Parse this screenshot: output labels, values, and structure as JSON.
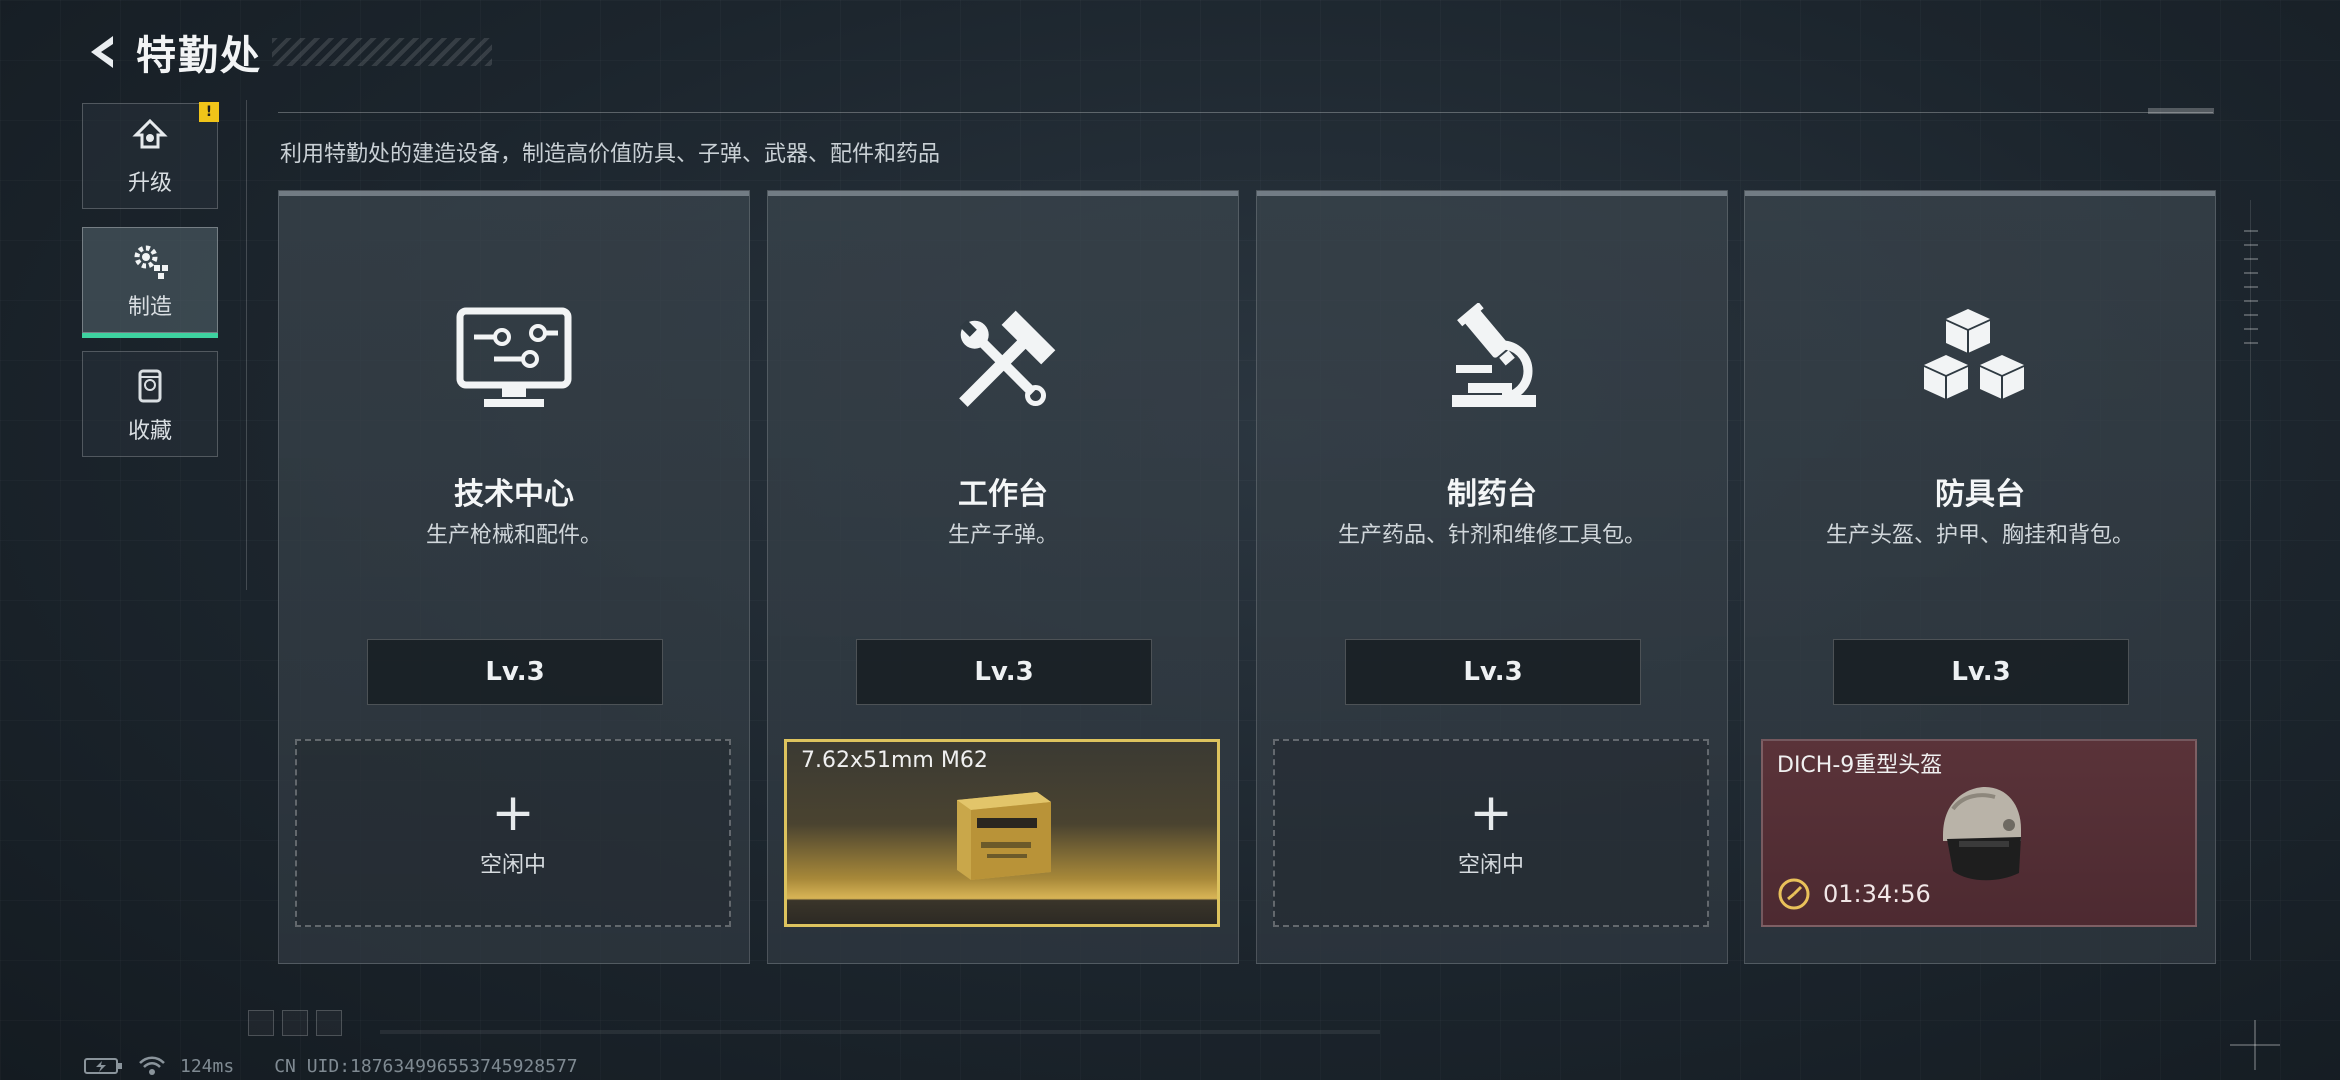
{
  "header": {
    "title": "特勤处"
  },
  "nav": {
    "items": [
      {
        "label": "升级",
        "icon": "upgrade-icon",
        "badge": "!"
      },
      {
        "label": "制造",
        "icon": "gears-icon",
        "active": true
      },
      {
        "label": "收藏",
        "icon": "collection-icon"
      }
    ]
  },
  "subtitle": "利用特勤处的建造设备，制造高价值防具、子弹、武器、配件和药品",
  "cards": [
    {
      "title": "技术中心",
      "desc": "生产枪械和配件。",
      "level": "Lv.3",
      "icon": "monitor-circuit-icon",
      "slot": {
        "state": "idle",
        "plus": "+",
        "label": "空闲中"
      }
    },
    {
      "title": "工作台",
      "desc": "生产子弹。",
      "level": "Lv.3",
      "icon": "hammer-wrench-icon",
      "slot": {
        "state": "producing",
        "item_name": "7.62x51mm M62",
        "item_icon": "ammo-box-icon",
        "accent": "#ddc35e"
      }
    },
    {
      "title": "制药台",
      "desc": "生产药品、针剂和维修工具包。",
      "level": "Lv.3",
      "icon": "microscope-icon",
      "slot": {
        "state": "idle",
        "plus": "+",
        "label": "空闲中"
      }
    },
    {
      "title": "防具台",
      "desc": "生产头盔、护甲、胸挂和背包。",
      "level": "Lv.3",
      "icon": "cubes-icon",
      "slot": {
        "state": "producing",
        "item_name": "DICH-9重型头盔",
        "item_icon": "helmet-icon",
        "timer": "01:34:56",
        "accent": "#5a3339"
      }
    }
  ],
  "status": {
    "ping": "124ms",
    "uid": "CN UID:18763499655374592857​7"
  },
  "colors": {
    "active_accent": "#3ed2a0",
    "alert": "#f0c419",
    "gold": "#ddc35e"
  }
}
